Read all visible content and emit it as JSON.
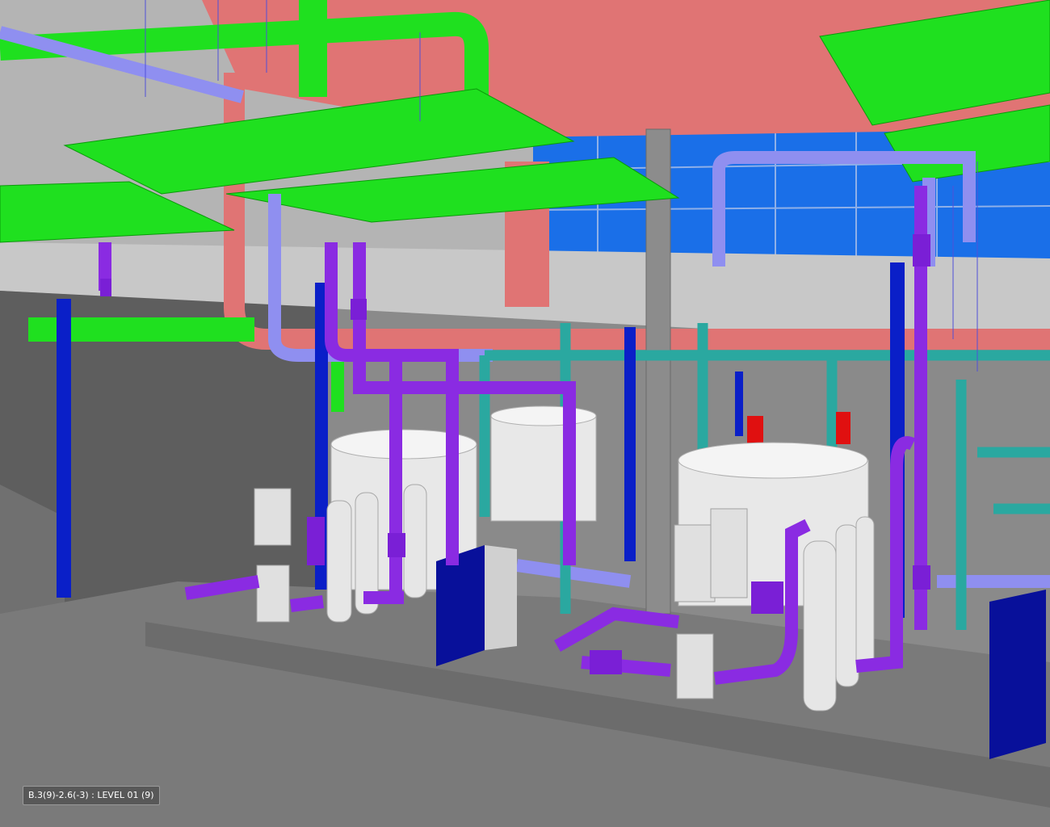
{
  "viewport": {
    "location_label": "B.3(9)-2.6(-3) : LEVEL 01 (9)"
  },
  "colors": {
    "duct_green": "#1fe01f",
    "duct_red": "#e07474",
    "pipe_purple": "#8a2be2",
    "pipe_lavender": "#8f8ff0",
    "pipe_teal": "#2aa8a0",
    "column_blue": "#0a1fc8",
    "equipment_white": "#e8e8e8",
    "heat_exchanger": "#08109a",
    "glazing_blue": "#1a6fe8",
    "floor_gray": "#7a7a7a",
    "valve_red": "#e01010"
  }
}
